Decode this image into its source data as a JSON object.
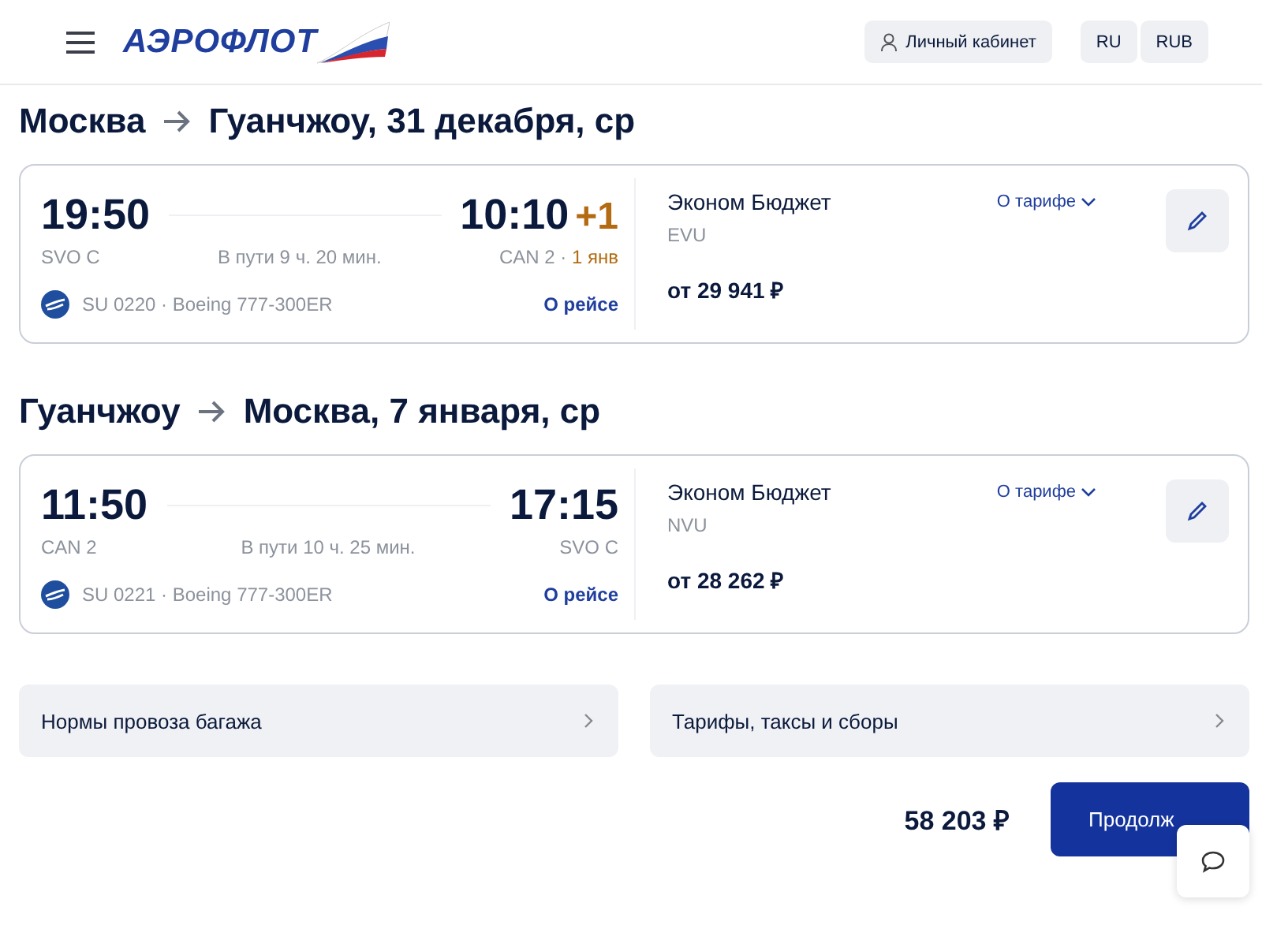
{
  "header": {
    "logo": "АЭРОФЛОТ",
    "account_button": "Личный кабинет",
    "language": "RU",
    "currency": "RUB"
  },
  "legs": [
    {
      "from": "Москва",
      "to": "Гуанчжоу, 31 декабря, ср",
      "depart_time": "19:50",
      "arrive_time": "10:10",
      "day_offset": "+1",
      "depart_airport": "SVO C",
      "duration": "В пути 9 ч. 20 мин.",
      "arrive_airport": "CAN 2",
      "date_separator": "·",
      "arrive_date": "1 янв",
      "flight": "SU 0220 · Boeing 777-300ER",
      "details_link": "О рейсе",
      "fare_name": "Эконом Бюджет",
      "fare_code": "EVU",
      "fare_price": "от 29 941 ₽",
      "fare_link": "О тарифе"
    },
    {
      "from": "Гуанчжоу",
      "to": "Москва, 7 января, ср",
      "depart_time": "11:50",
      "arrive_time": "17:15",
      "depart_airport": "CAN 2",
      "duration": "В пути 10 ч. 25 мин.",
      "arrive_airport": "SVO C",
      "flight": "SU 0221 · Boeing 777-300ER",
      "details_link": "О рейсе",
      "fare_name": "Эконом Бюджет",
      "fare_code": "NVU",
      "fare_price": "от 28 262 ₽",
      "fare_link": "О тарифе"
    }
  ],
  "info_rows": [
    "Нормы провоза багажа",
    "Тарифы, таксы и сборы"
  ],
  "footer": {
    "total": "58 203 ₽",
    "continue_button": "Продолж"
  }
}
